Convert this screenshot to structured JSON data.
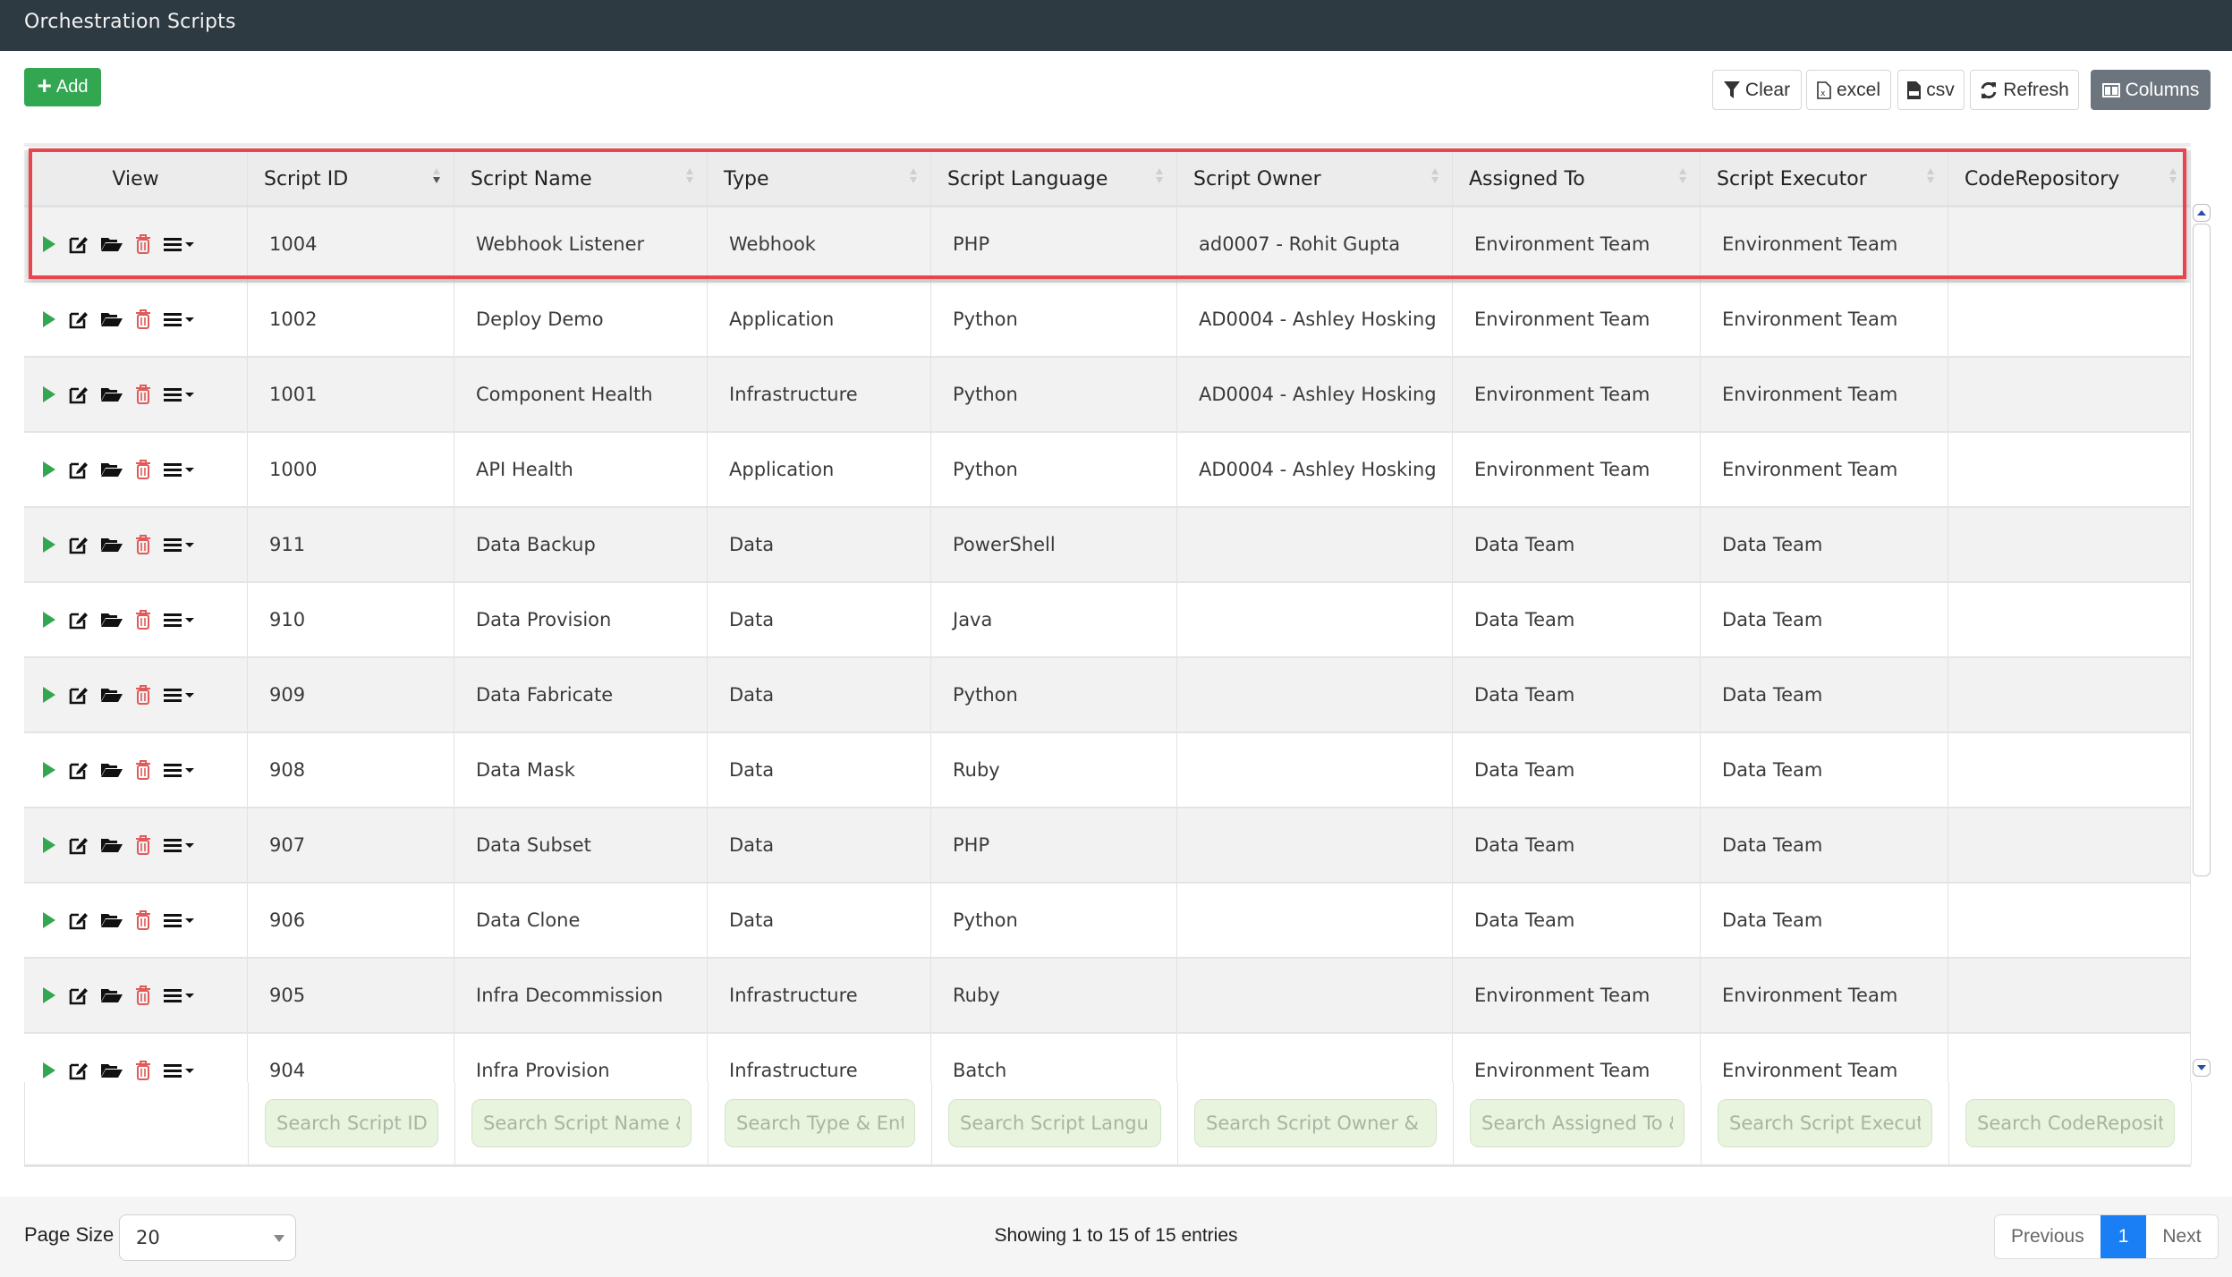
{
  "app": {
    "title": "Orchestration Scripts"
  },
  "toolbar": {
    "add_label": "Add",
    "clear_label": "Clear",
    "excel_label": "excel",
    "csv_label": "csv",
    "refresh_label": "Refresh",
    "columns_label": "Columns"
  },
  "colors": {
    "titlebar": "#2e3a42",
    "add_button": "#33a652",
    "columns_button": "#6c757d",
    "play_icon": "#33a652",
    "delete_icon": "#e05a5a",
    "highlight_border": "#e8454f",
    "search_input_bg": "#e8f4dd",
    "active_page": "#1a7ff5"
  },
  "table": {
    "columns": [
      {
        "key": "view",
        "label": "View",
        "sortable": false
      },
      {
        "key": "id",
        "label": "Script ID",
        "sortable": true,
        "sort": "desc"
      },
      {
        "key": "name",
        "label": "Script Name",
        "sortable": true
      },
      {
        "key": "type",
        "label": "Type",
        "sortable": true
      },
      {
        "key": "language",
        "label": "Script Language",
        "sortable": true
      },
      {
        "key": "owner",
        "label": "Script Owner",
        "sortable": true
      },
      {
        "key": "assigned",
        "label": "Assigned To",
        "sortable": true
      },
      {
        "key": "executor",
        "label": "Script Executor",
        "sortable": true
      },
      {
        "key": "repo",
        "label": "CodeRepository",
        "sortable": true
      }
    ],
    "row_actions": [
      "play-icon",
      "edit-icon",
      "folder-open-icon",
      "trash-icon",
      "menu-dropdown-icon"
    ],
    "rows": [
      {
        "id": "1004",
        "name": "Webhook Listener",
        "type": "Webhook",
        "language": "PHP",
        "owner": "ad0007 - Rohit Gupta",
        "assigned": "Environment Team",
        "executor": "Environment Team",
        "repo": "",
        "highlighted": true
      },
      {
        "id": "1002",
        "name": "Deploy Demo",
        "type": "Application",
        "language": "Python",
        "owner": "AD0004 - Ashley Hosking",
        "assigned": "Environment Team",
        "executor": "Environment Team",
        "repo": ""
      },
      {
        "id": "1001",
        "name": "Component Health",
        "type": "Infrastructure",
        "language": "Python",
        "owner": "AD0004 - Ashley Hosking",
        "assigned": "Environment Team",
        "executor": "Environment Team",
        "repo": ""
      },
      {
        "id": "1000",
        "name": "API Health",
        "type": "Application",
        "language": "Python",
        "owner": "AD0004 - Ashley Hosking",
        "assigned": "Environment Team",
        "executor": "Environment Team",
        "repo": ""
      },
      {
        "id": "911",
        "name": "Data Backup",
        "type": "Data",
        "language": "PowerShell",
        "owner": "",
        "assigned": "Data Team",
        "executor": "Data Team",
        "repo": ""
      },
      {
        "id": "910",
        "name": "Data Provision",
        "type": "Data",
        "language": "Java",
        "owner": "",
        "assigned": "Data Team",
        "executor": "Data Team",
        "repo": ""
      },
      {
        "id": "909",
        "name": "Data Fabricate",
        "type": "Data",
        "language": "Python",
        "owner": "",
        "assigned": "Data Team",
        "executor": "Data Team",
        "repo": ""
      },
      {
        "id": "908",
        "name": "Data Mask",
        "type": "Data",
        "language": "Ruby",
        "owner": "",
        "assigned": "Data Team",
        "executor": "Data Team",
        "repo": ""
      },
      {
        "id": "907",
        "name": "Data Subset",
        "type": "Data",
        "language": "PHP",
        "owner": "",
        "assigned": "Data Team",
        "executor": "Data Team",
        "repo": ""
      },
      {
        "id": "906",
        "name": "Data Clone",
        "type": "Data",
        "language": "Python",
        "owner": "",
        "assigned": "Data Team",
        "executor": "Data Team",
        "repo": ""
      },
      {
        "id": "905",
        "name": "Infra Decommission",
        "type": "Infrastructure",
        "language": "Ruby",
        "owner": "",
        "assigned": "Environment Team",
        "executor": "Environment Team",
        "repo": ""
      },
      {
        "id": "904",
        "name": "Infra Provision",
        "type": "Infrastructure",
        "language": "Batch",
        "owner": "",
        "assigned": "Environment Team",
        "executor": "Environment Team",
        "repo": ""
      }
    ],
    "search_placeholders": [
      "",
      "Search Script ID",
      "Search Script Name & Description",
      "Search Type & Entity",
      "Search Script Language",
      "Search Script Owner & Email",
      "Search Assigned To & Email",
      "Search Script Executor",
      "Search CodeRepository"
    ]
  },
  "footer": {
    "page_size_label": "Page Size",
    "page_size_value": "20",
    "info": "Showing 1 to 15 of 15 entries",
    "previous_label": "Previous",
    "current_page": "1",
    "next_label": "Next"
  }
}
